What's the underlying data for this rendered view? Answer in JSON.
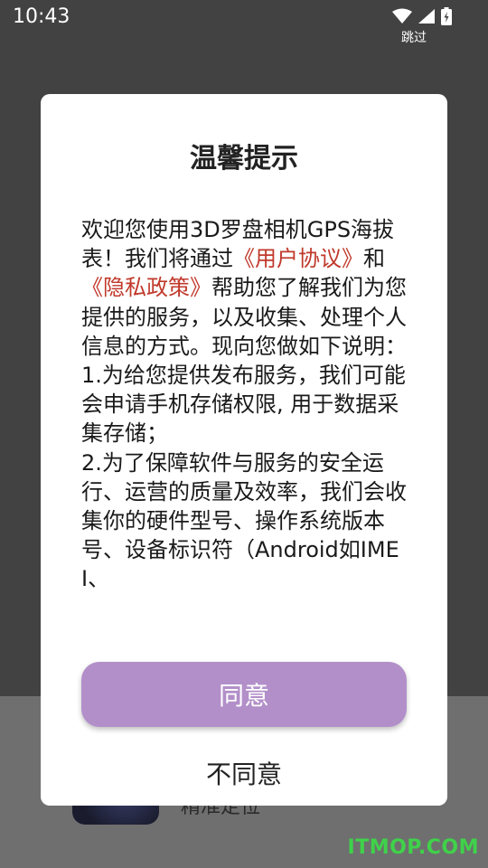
{
  "status_bar": {
    "time": "10:43",
    "skip_label": "跳过",
    "icons": [
      "wifi-icon",
      "signal-icon",
      "battery-icon"
    ]
  },
  "background": {
    "app_subtitle": "精准定位",
    "watermark": "ITMOP.COM"
  },
  "dialog": {
    "title": "温馨提示",
    "body": {
      "intro_prefix": "欢迎您使用3D罗盘相机GPS海拔表！我们将通过",
      "link_user_agreement": "《用户协议》",
      "conj": "和",
      "link_privacy_policy": "《隐私政策》",
      "intro_suffix": "帮助您了解我们为您提供的服务，以及收集、处理个人信息的方式。现向您做如下说明：",
      "item1": "1.为给您提供发布服务，我们可能会申请手机存储权限, 用于数据采集存储；",
      "item2": "2.为了保障软件与服务的安全运行、运营的质量及效率，我们会收集你的硬件型号、操作系统版本号、设备标识符（Android如IMEI、"
    },
    "agree_label": "同意",
    "disagree_label": "不同意"
  },
  "colors": {
    "link": "#c0392b",
    "agree_button": "#b28fc9",
    "watermark": "#3fd24a"
  }
}
